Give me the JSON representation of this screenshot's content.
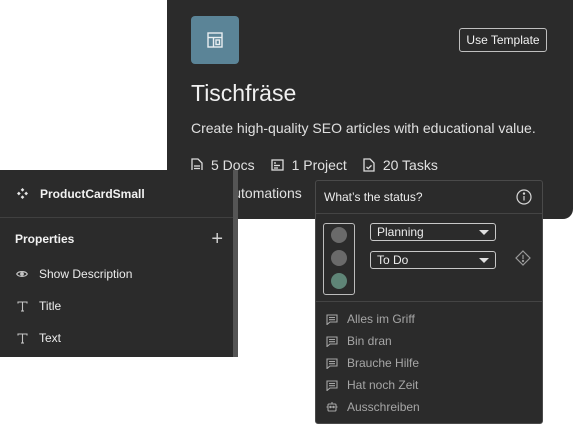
{
  "template_card": {
    "title": "Tischfräse",
    "description": "Create high-quality SEO articles with educational value.",
    "use_template_label": "Use Template",
    "icon": "layout-template-icon",
    "accent_color": "#5b8497",
    "stats": {
      "docs": "5 Docs",
      "project": "1 Project",
      "tasks": "20 Tasks",
      "automations": "2 Automations"
    }
  },
  "properties_panel": {
    "component_name": "ProductCardSmall",
    "section_title": "Properties",
    "add_icon": "plus-icon",
    "items": [
      {
        "label": "Show Description",
        "icon": "eye-icon"
      },
      {
        "label": "Title",
        "icon": "text-icon"
      },
      {
        "label": "Text",
        "icon": "text-icon"
      }
    ]
  },
  "status_dropdown": {
    "question": "What’s the status?",
    "info_icon": "info-icon",
    "primary_select": "Planning",
    "secondary_select": "To Do",
    "traffic_light": {
      "active_index": 2,
      "active_color": "#5f8577",
      "inactive_color": "#6a6a6a"
    },
    "warning_icon": "diamond-warning-icon",
    "options": [
      {
        "label": "Alles im Griff",
        "icon": "comment-icon"
      },
      {
        "label": "Bin dran",
        "icon": "comment-icon"
      },
      {
        "label": "Brauche Hilfe",
        "icon": "comment-icon"
      },
      {
        "label": "Hat noch Zeit",
        "icon": "comment-icon"
      },
      {
        "label": "Ausschreiben",
        "icon": "robot-icon"
      }
    ]
  }
}
